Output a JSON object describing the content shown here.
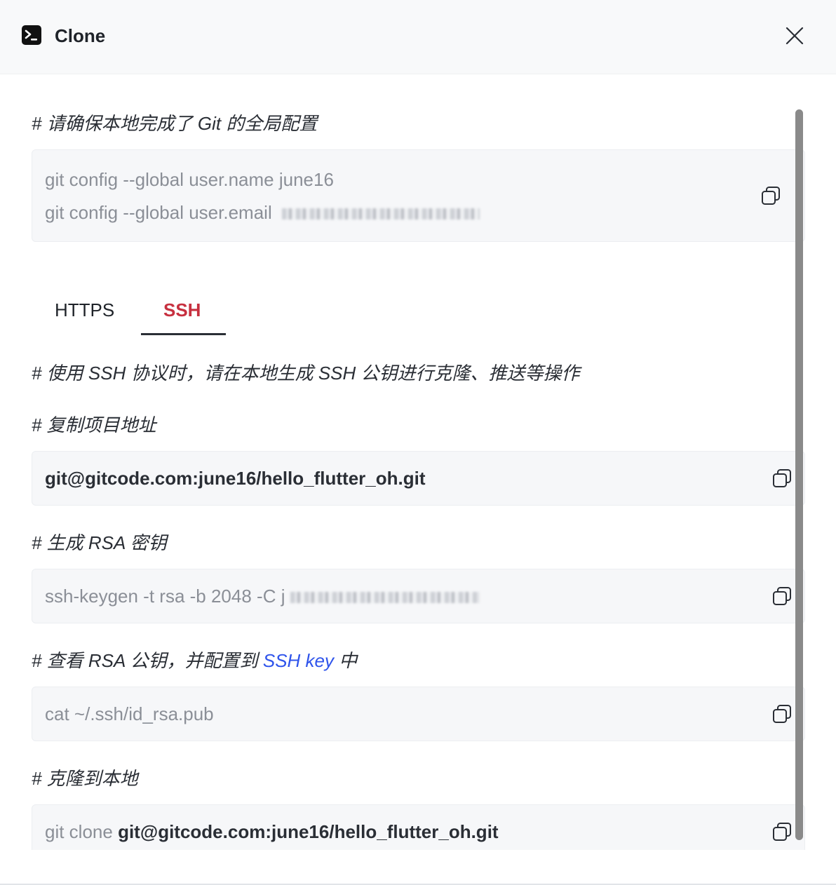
{
  "dialog": {
    "title": "Clone",
    "title_icon": "terminal-icon",
    "close_icon": "close-icon"
  },
  "git_config": {
    "comment": "# 请确保本地完成了 Git 的全局配置",
    "line1": "git config --global user.name june16",
    "line2_prefix": "git config --global user.email"
  },
  "tabs": [
    {
      "label": "HTTPS",
      "active": false
    },
    {
      "label": "SSH",
      "active": true
    }
  ],
  "ssh": {
    "intro_comment": "# 使用 SSH 协议时，请在本地生成 SSH 公钥进行克隆、推送等操作",
    "copy_address_comment": "# 复制项目地址",
    "address": "git@gitcode.com:june16/hello_flutter_oh.git",
    "keygen_comment": "# 生成 RSA 密钥",
    "keygen_command": "ssh-keygen -t rsa -b 2048 -C j",
    "view_key_comment_prefix": "# 查看 RSA 公钥，并配置到 ",
    "view_key_comment_link": "SSH key",
    "view_key_comment_suffix": " 中",
    "cat_command": "cat ~/.ssh/id_rsa.pub",
    "clone_comment": "# 克隆到本地",
    "clone_prefix": "git clone ",
    "clone_address": "git@gitcode.com:june16/hello_flutter_oh.git"
  },
  "colors": {
    "active_tab": "#c7303f",
    "link": "#2f54eb",
    "code_bg": "#f6f7f9"
  }
}
